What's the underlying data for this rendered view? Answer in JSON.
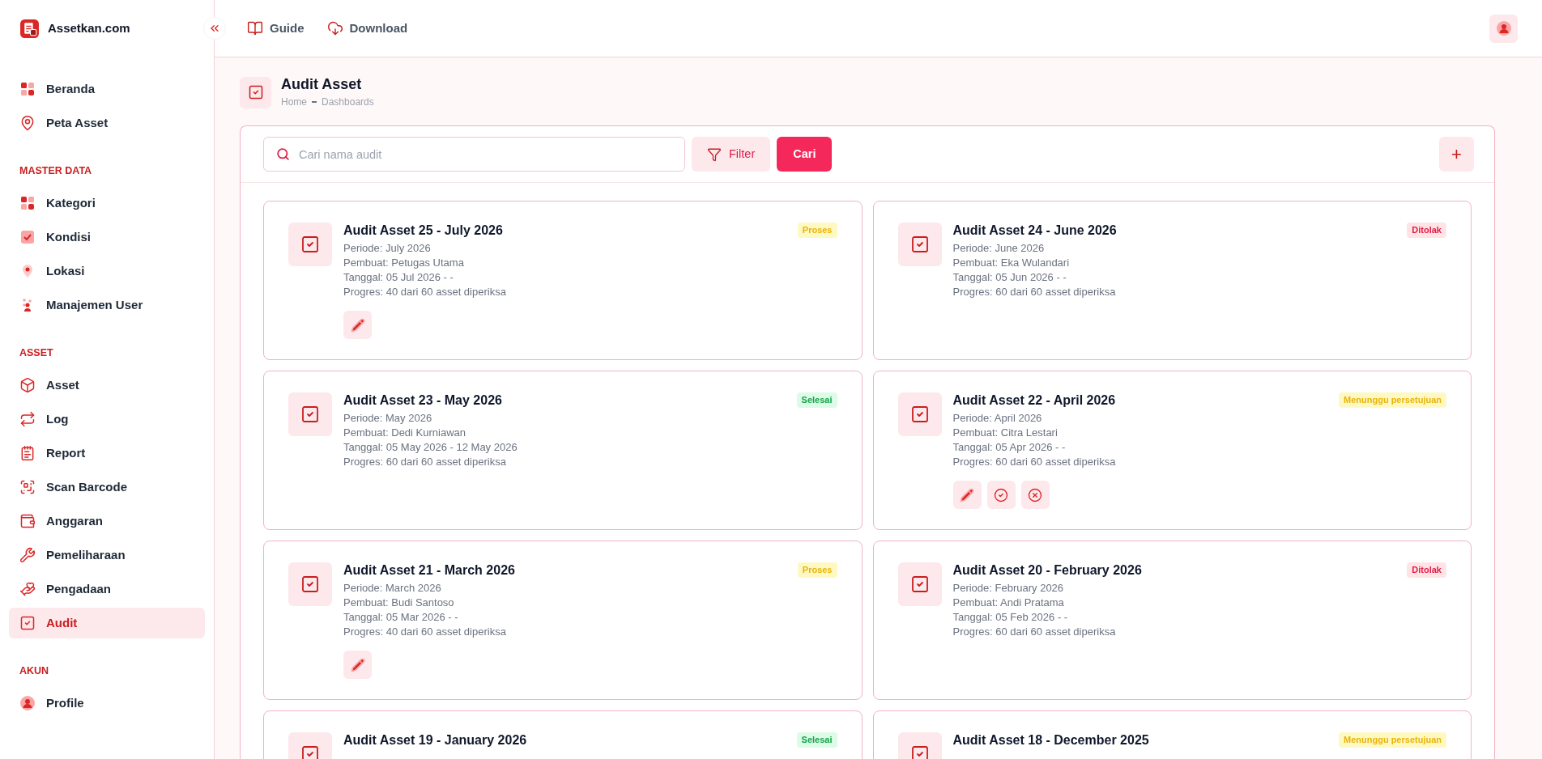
{
  "brand": {
    "name": "Assetkan.com"
  },
  "topbar": {
    "links": [
      "Guide",
      "Download"
    ]
  },
  "sidebar": {
    "sections": [
      {
        "items": [
          {
            "label": "Beranda",
            "selected": false
          },
          {
            "label": "Peta Asset",
            "selected": false
          }
        ]
      },
      {
        "heading": "MASTER DATA",
        "items": [
          {
            "label": "Kategori",
            "selected": false
          },
          {
            "label": "Kondisi",
            "selected": false
          },
          {
            "label": "Lokasi",
            "selected": false
          },
          {
            "label": "Manajemen User",
            "selected": false
          }
        ]
      },
      {
        "heading": "ASSET",
        "items": [
          {
            "label": "Asset",
            "selected": false
          },
          {
            "label": "Log",
            "selected": false
          },
          {
            "label": "Report",
            "selected": false
          },
          {
            "label": "Scan Barcode",
            "selected": false
          },
          {
            "label": "Anggaran",
            "selected": false
          },
          {
            "label": "Pemeliharaan",
            "selected": false
          },
          {
            "label": "Pengadaan",
            "selected": false
          },
          {
            "label": "Audit",
            "selected": true
          }
        ]
      },
      {
        "heading": "AKUN",
        "items": [
          {
            "label": "Profile",
            "selected": false
          }
        ]
      }
    ]
  },
  "page": {
    "title": "Audit Asset",
    "breadcrumb": [
      "Home",
      "Dashboards"
    ]
  },
  "toolbar": {
    "search": {
      "placeholder": "Cari nama audit"
    },
    "filter_label": "Filter",
    "search_button": "Cari",
    "add_label": "+"
  },
  "audits": [
    {
      "title": "Audit Asset 25 - July 2026",
      "status": {
        "label": "Proses",
        "kind": "process"
      },
      "details": [
        "Periode: July 2026",
        "Pembuat: Petugas Utama",
        "Tanggal: 05 Jul 2026 - -",
        "Progres: 40 dari 60 asset diperiksa"
      ],
      "actions": [
        {
          "kind": "edit"
        }
      ]
    },
    {
      "title": "Audit Asset 24 - June 2026",
      "status": {
        "label": "Ditolak",
        "kind": "rejected"
      },
      "details": [
        "Periode: June 2026",
        "Pembuat: Eka Wulandari",
        "Tanggal: 05 Jun 2026 - -",
        "Progres: 60 dari 60 asset diperiksa"
      ]
    },
    {
      "title": "Audit Asset 23 - May 2026",
      "status": {
        "label": "Selesai",
        "kind": "done"
      },
      "details": [
        "Periode: May 2026",
        "Pembuat: Dedi Kurniawan",
        "Tanggal: 05 May 2026 - 12 May 2026",
        "Progres: 60 dari 60 asset diperiksa"
      ]
    },
    {
      "title": "Audit Asset 22 - April 2026",
      "status": {
        "label": "Menunggu persetujuan",
        "kind": "pending"
      },
      "details": [
        "Periode: April 2026",
        "Pembuat: Citra Lestari",
        "Tanggal: 05 Apr 2026 - -",
        "Progres: 60 dari 60 asset diperiksa"
      ],
      "actions": [
        {
          "kind": "edit"
        },
        {
          "kind": "approve"
        },
        {
          "kind": "reject"
        }
      ]
    },
    {
      "title": "Audit Asset 21 - March 2026",
      "status": {
        "label": "Proses",
        "kind": "process"
      },
      "details": [
        "Periode: March 2026",
        "Pembuat: Budi Santoso",
        "Tanggal: 05 Mar 2026 - -",
        "Progres: 40 dari 60 asset diperiksa"
      ],
      "actions": [
        {
          "kind": "edit"
        }
      ]
    },
    {
      "title": "Audit Asset 20 - February 2026",
      "status": {
        "label": "Ditolak",
        "kind": "rejected"
      },
      "details": [
        "Periode: February 2026",
        "Pembuat: Andi Pratama",
        "Tanggal: 05 Feb 2026 - -",
        "Progres: 60 dari 60 asset diperiksa"
      ]
    },
    {
      "title": "Audit Asset 19 - January 2026",
      "status": {
        "label": "Selesai",
        "kind": "done"
      }
    },
    {
      "title": "Audit Asset 18 - December 2025",
      "status": {
        "label": "Menunggu persetujuan",
        "kind": "pending"
      }
    }
  ]
}
